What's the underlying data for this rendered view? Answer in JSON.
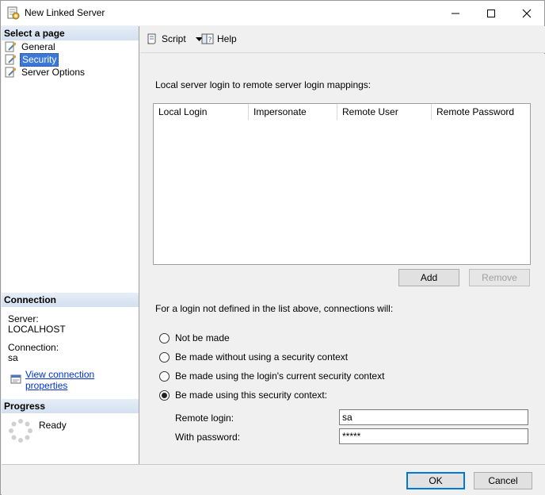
{
  "window": {
    "title": "New Linked Server",
    "icon": "linked-server-icon"
  },
  "left_pane": {
    "select_page_header": "Select a page",
    "pages": [
      {
        "label": "General",
        "icon": "page-wrench-icon",
        "selected": false
      },
      {
        "label": "Security",
        "icon": "page-wrench-icon",
        "selected": true
      },
      {
        "label": "Server Options",
        "icon": "page-wrench-icon",
        "selected": false
      }
    ],
    "connection_header": "Connection",
    "server_label": "Server:",
    "server_value": "LOCALHOST",
    "connection_label": "Connection:",
    "connection_value": "sa",
    "view_connection_link": "View connection properties",
    "progress_header": "Progress",
    "progress_status": "Ready"
  },
  "toolbar": {
    "script_label": "Script",
    "help_label": "Help"
  },
  "security": {
    "mappings_label": "Local server login to remote server login mappings:",
    "columns": [
      "Local Login",
      "Impersonate",
      "Remote User",
      "Remote Password"
    ],
    "add_label": "Add",
    "remove_label": "Remove",
    "not_defined_label": "For a login not defined in the list above, connections will:",
    "options": [
      {
        "label": "Not be made",
        "checked": false
      },
      {
        "label": "Be made without using a security context",
        "checked": false
      },
      {
        "label": "Be made using the login's current security context",
        "checked": false
      },
      {
        "label": "Be made using this security context:",
        "checked": true
      }
    ],
    "remote_login_label": "Remote login:",
    "remote_login_value": "sa",
    "with_password_label": "With password:",
    "with_password_value": "*****"
  },
  "footer": {
    "ok_label": "OK",
    "cancel_label": "Cancel"
  },
  "colors": {
    "section_header": "#d3e0f0",
    "selection": "#3c78d8",
    "link": "#0033cc",
    "default_button_border": "#0078d7"
  }
}
